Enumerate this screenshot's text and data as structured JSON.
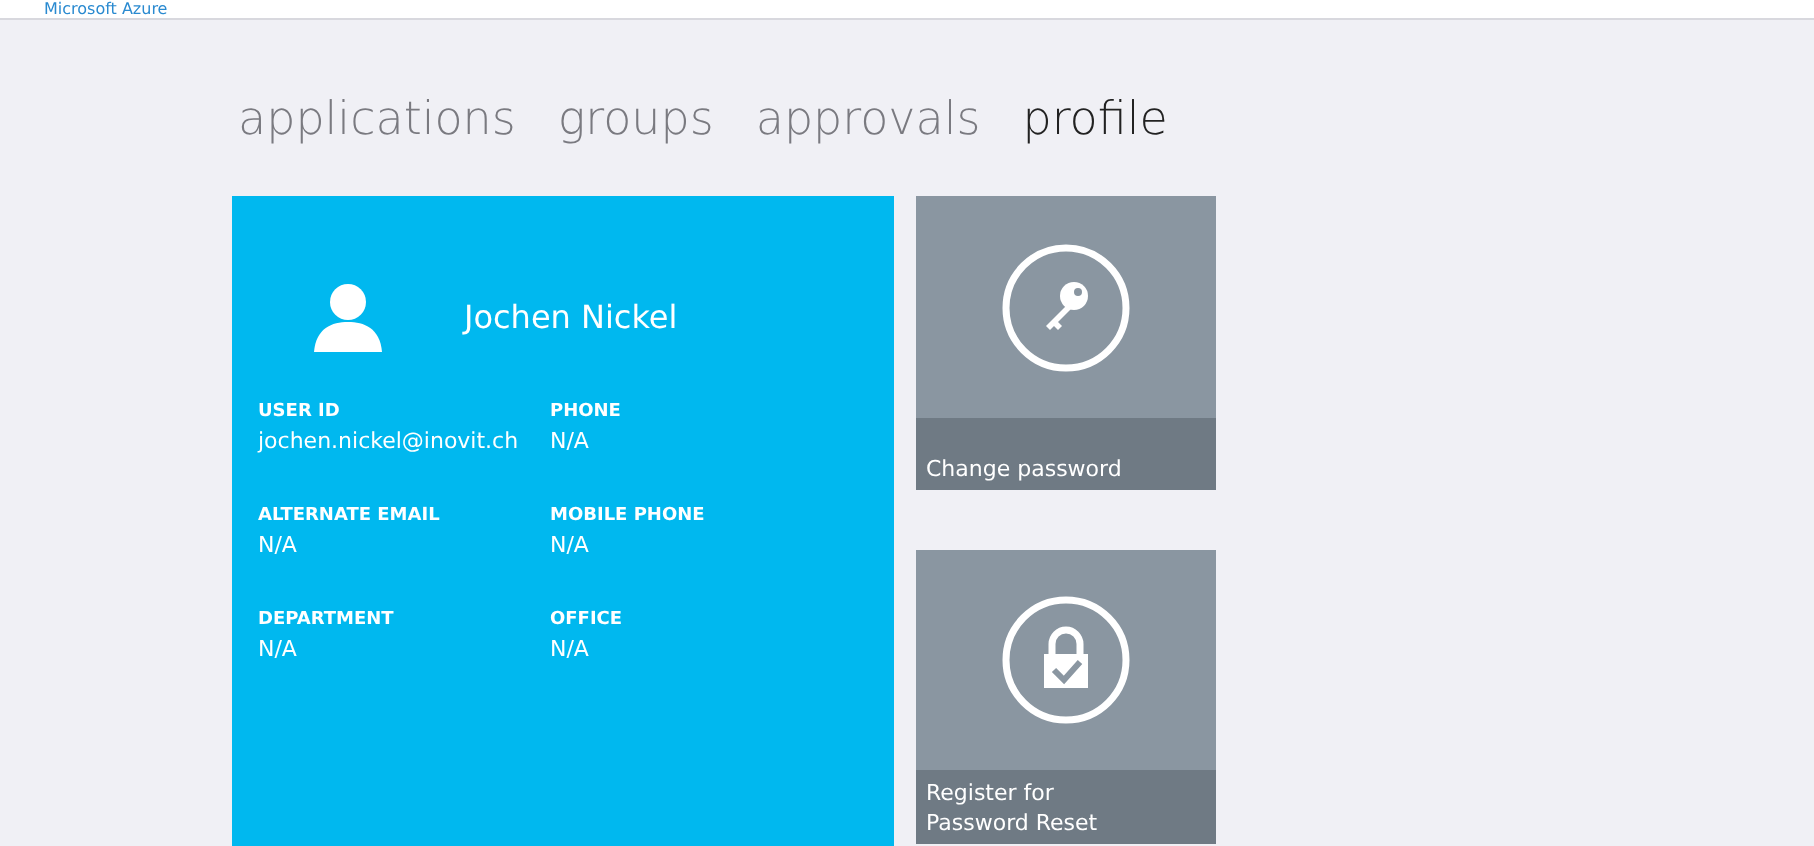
{
  "header": {
    "title": "Microsoft Azure"
  },
  "tabs": [
    {
      "label": "applications",
      "selected": false
    },
    {
      "label": "groups",
      "selected": false
    },
    {
      "label": "approvals",
      "selected": false
    },
    {
      "label": "profile",
      "selected": true
    }
  ],
  "profile": {
    "name": "Jochen Nickel",
    "fields": [
      {
        "label": "USER ID",
        "value": "jochen.nickel@inovit.ch"
      },
      {
        "label": "PHONE",
        "value": "N/A"
      },
      {
        "label": "ALTERNATE EMAIL",
        "value": "N/A"
      },
      {
        "label": "MOBILE PHONE",
        "value": "N/A"
      },
      {
        "label": "DEPARTMENT",
        "value": "N/A"
      },
      {
        "label": "OFFICE",
        "value": "N/A"
      }
    ]
  },
  "tiles": [
    {
      "kind": "key",
      "label": "Change password"
    },
    {
      "kind": "lock",
      "label": "Register for Password Reset"
    }
  ]
}
